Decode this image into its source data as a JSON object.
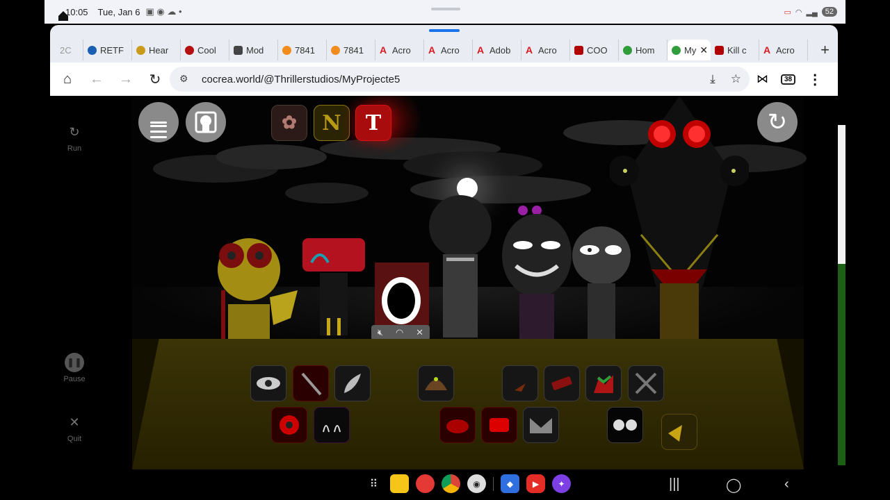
{
  "status_bar": {
    "time": "10:05",
    "date": "Tue, Jan 6",
    "battery": "52"
  },
  "browser": {
    "tabs": [
      {
        "label": "RETF",
        "color": "#1a5fb4"
      },
      {
        "label": "Hear",
        "color": "#c99b18"
      },
      {
        "label": "Cool",
        "color": "#b50f0f"
      },
      {
        "label": "Mod",
        "color": "#444444"
      },
      {
        "label": "7841",
        "color": "#f28c1c"
      },
      {
        "label": "7841",
        "color": "#f28c1c"
      },
      {
        "label": "Acro",
        "color": "#d71920"
      },
      {
        "label": "Acro",
        "color": "#d71920"
      },
      {
        "label": "Adob",
        "color": "#d71920"
      },
      {
        "label": "Acro",
        "color": "#d71920"
      },
      {
        "label": "COO",
        "color": "#b00000"
      },
      {
        "label": "Hom",
        "color": "#2e9d3a"
      },
      {
        "label": "My",
        "color": "#2e9d3a",
        "active": true
      },
      {
        "label": "Kill c",
        "color": "#b00000"
      },
      {
        "label": "Acro",
        "color": "#d71920"
      }
    ],
    "url": "cocrea.world/@Thrillerstudios/MyProjecte5",
    "tab_count": "38"
  },
  "game": {
    "sidebar": {
      "run_label": "Run",
      "pause_label": "Pause",
      "quit_label": "Quit"
    },
    "mode_buttons": [
      {
        "label": "",
        "icon": "paw-icon"
      },
      {
        "label": "N",
        "icon": "n-letter-icon"
      },
      {
        "label": "T",
        "icon": "t-letter-icon"
      }
    ]
  },
  "dock_apps": [
    "app-grid-icon",
    "files-icon",
    "contacts-icon",
    "chrome-icon",
    "camera-icon",
    "roblox-icon",
    "youtube-icon",
    "galaxy-store-icon"
  ]
}
